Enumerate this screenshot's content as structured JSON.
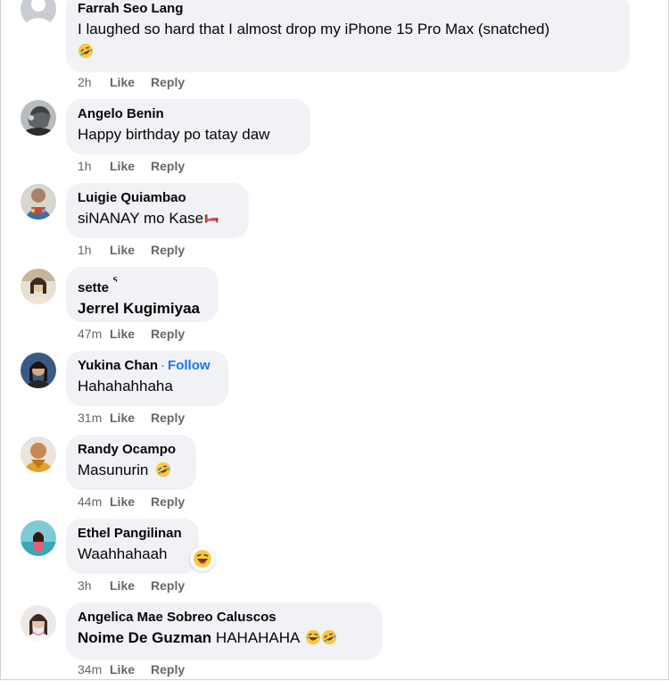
{
  "comments": [
    {
      "name": "Farrah Seo Lang",
      "text_line1": "I laughed so hard that I almost drop my iPhone 15 Pro Max (snatched)",
      "emoji": "rofl-emoji",
      "time": "2h",
      "like": "Like",
      "reply": "Reply"
    },
    {
      "name": "Angelo Benin",
      "text": "Happy birthday po tatay daw",
      "time": "1h",
      "like": "Like",
      "reply": "Reply"
    },
    {
      "name": "Luigie Quiambao",
      "text": "siNANAY mo Kase",
      "emoji": "bed-emoji",
      "time": "1h",
      "like": "Like",
      "reply": "Reply"
    },
    {
      "name": "sette",
      "name_suffix": "ᕐ",
      "text_bold": "Jerrel Kugimiyaa",
      "time": "47m",
      "like": "Like",
      "reply": "Reply"
    },
    {
      "name": "Yukina Chan",
      "separator": "·",
      "follow": "Follow",
      "text": "Hahahahhaha",
      "time": "31m",
      "like": "Like",
      "reply": "Reply"
    },
    {
      "name": "Randy Ocampo",
      "text": "Masunurin",
      "emoji": "rofl-emoji",
      "time": "44m",
      "like": "Like",
      "reply": "Reply"
    },
    {
      "name": "Ethel Pangilinan",
      "text": "Waahhahaah",
      "reaction": "haha-emoji",
      "time": "3h",
      "like": "Like",
      "reply": "Reply"
    },
    {
      "name": "Angelica Mae Sobreo Caluscos",
      "text_bold": "Noime De Guzman",
      "text_rest": " HAHAHAHA",
      "emoji": "haha-rofl-emoji",
      "time": "34m",
      "like": "Like",
      "reply": "Reply"
    }
  ],
  "colors": {
    "bubble": "#f0f2f5",
    "meta": "#65676b",
    "follow": "#1877f2"
  }
}
